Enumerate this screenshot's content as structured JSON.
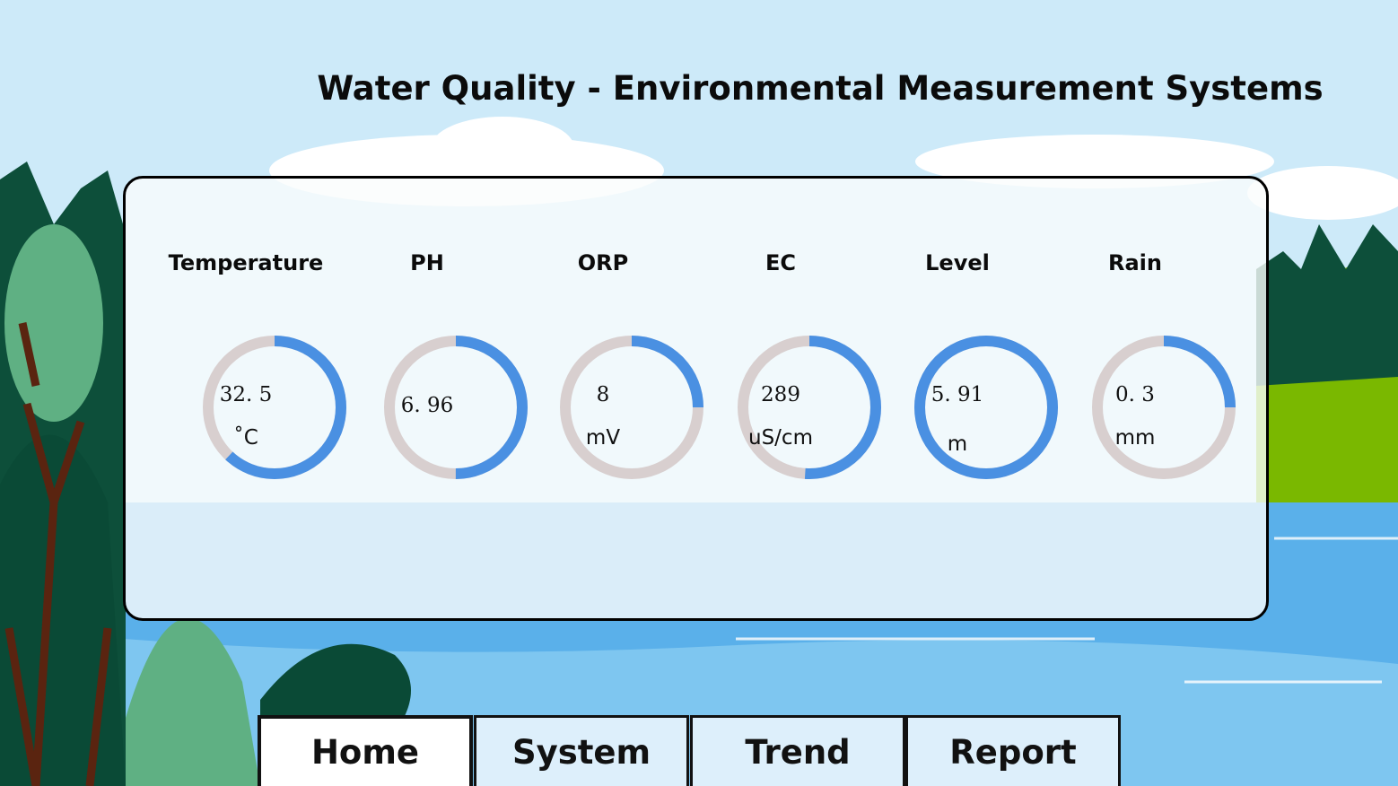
{
  "header": {
    "title": "Water Quality - Environmental Measurement Systems"
  },
  "colors": {
    "ring_track": "#d8cfcf",
    "ring_fill": "#4a90e2",
    "sky": "#cdeaf9",
    "water": "#5ab0ea"
  },
  "gauges": [
    {
      "label": "Temperature",
      "value": "32. 5",
      "unit": "˚C",
      "fraction": 0.62
    },
    {
      "label": "PH",
      "value": "6. 96",
      "unit": "",
      "fraction": 0.5
    },
    {
      "label": "ORP",
      "value": "8",
      "unit": "mV",
      "fraction": 0.25
    },
    {
      "label": "EC",
      "value": "289",
      "unit": "uS/cm",
      "fraction": 0.51
    },
    {
      "label": "Level",
      "value": "5. 91",
      "unit": "m",
      "fraction": 1.0
    },
    {
      "label": "Rain",
      "value": "0. 3",
      "unit": "mm",
      "fraction": 0.25
    }
  ],
  "nav": {
    "items": [
      {
        "label": "Home",
        "active": true
      },
      {
        "label": "System",
        "active": false
      },
      {
        "label": "Trend",
        "active": false
      },
      {
        "label": "Report",
        "active": false
      }
    ]
  }
}
